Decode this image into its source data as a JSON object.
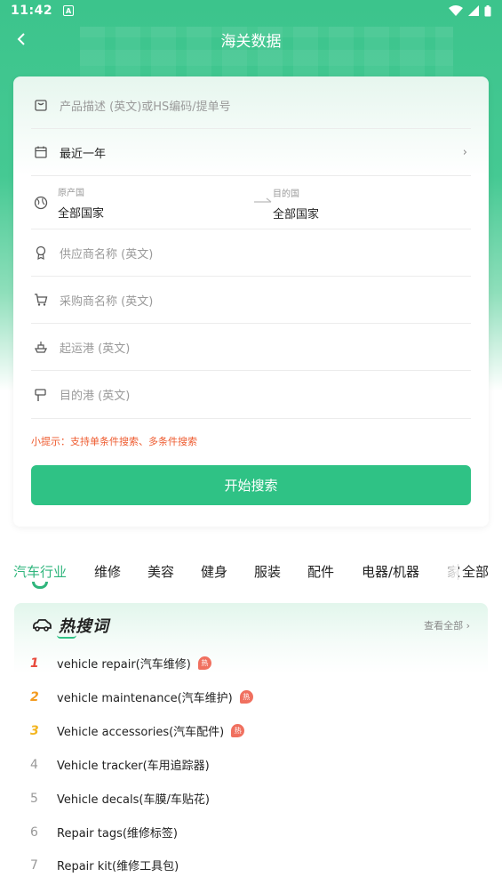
{
  "status_bar": {
    "time": "11:42",
    "notif_glyph": "A"
  },
  "header": {
    "title": "海关数据"
  },
  "search": {
    "product_placeholder": "产品描述 (英文)或HS编码/提单号",
    "date_range": "最近一年",
    "origin_label": "原产国",
    "origin_value": "全部国家",
    "dest_label": "目的国",
    "dest_value": "全部国家",
    "supplier_placeholder": "供应商名称 (英文)",
    "buyer_placeholder": "采购商名称 (英文)",
    "departure_port_placeholder": "起运港 (英文)",
    "dest_port_placeholder": "目的港 (英文)",
    "tip": "小提示：支持单条件搜索、多条件搜索",
    "button_label": "开始搜索"
  },
  "categories": {
    "tabs": [
      "汽车行业",
      "维修",
      "美容",
      "健身",
      "服装",
      "配件",
      "电器/机器",
      "家"
    ],
    "active_index": 0,
    "all_label": "全部"
  },
  "hot": {
    "title": "热搜词",
    "view_all": "查看全部",
    "badge": "热",
    "items": [
      {
        "rank": "1",
        "text": "vehicle repair(汽车维修)",
        "hot": true
      },
      {
        "rank": "2",
        "text": "vehicle maintenance(汽车维护)",
        "hot": true
      },
      {
        "rank": "3",
        "text": "Vehicle accessories(汽车配件)",
        "hot": true
      },
      {
        "rank": "4",
        "text": "Vehicle tracker(车用追踪器)",
        "hot": false
      },
      {
        "rank": "5",
        "text": "Vehicle decals(车膜/车贴花)",
        "hot": false
      },
      {
        "rank": "6",
        "text": "Repair tags(维修标签)",
        "hot": false
      },
      {
        "rank": "7",
        "text": "Repair kit(维修工具包)",
        "hot": false
      }
    ]
  },
  "colors": {
    "brand_green": "#2fc285",
    "tip_orange": "#ee5a2e",
    "hot_red": "#f0705f"
  }
}
